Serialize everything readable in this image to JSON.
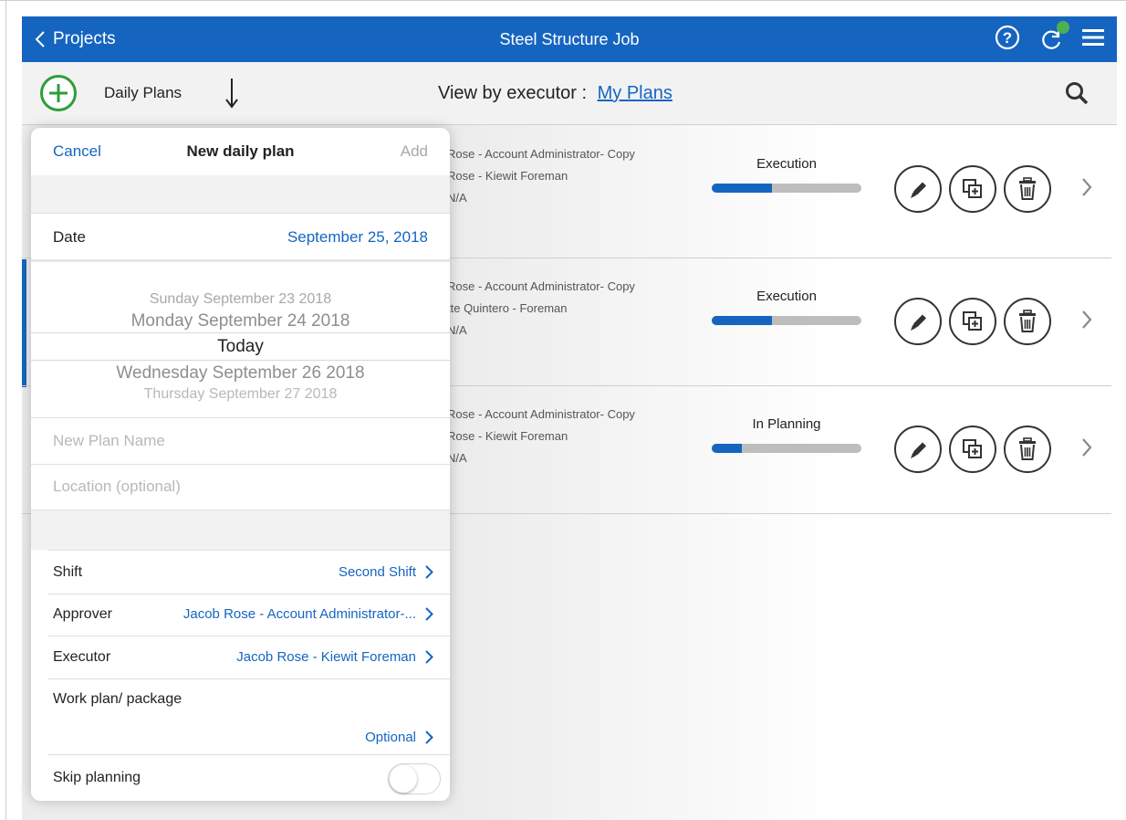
{
  "topbar": {
    "back_label": "Projects",
    "title": "Steel Structure Job",
    "accent_color": "#1565c0",
    "icons": [
      "help-icon",
      "sync-icon",
      "menu-icon"
    ],
    "sync_badge_color": "#4caf50"
  },
  "subheader": {
    "daily_plans_label": "Daily Plans",
    "view_by_label": "View by executor  :",
    "view_by_value": "My Plans"
  },
  "plans": [
    {
      "approver": "Rose - Account Administrator- Copy",
      "executor": "Rose - Kiewit Foreman",
      "location": "N/A",
      "status": "Execution",
      "progress": 0.4
    },
    {
      "approver": "Rose - Account Administrator- Copy",
      "executor": "tte Quintero - Foreman",
      "location": "N/A",
      "status": "Execution",
      "progress": 0.4
    },
    {
      "approver": "Rose - Account Administrator- Copy",
      "executor": "Rose - Kiewit Foreman",
      "location": "N/A",
      "status": "In Planning",
      "progress": 0.2
    }
  ],
  "panel": {
    "cancel_label": "Cancel",
    "title": "New daily plan",
    "add_label": "Add",
    "date_label": "Date",
    "date_value": "September 25, 2018",
    "picker_options": [
      "Sunday September 23 2018",
      "Monday September 24 2018",
      "Today",
      "Wednesday September 26 2018",
      "Thursday September 27 2018"
    ],
    "plan_name_placeholder": "New Plan Name",
    "location_placeholder": "Location (optional)",
    "shift_label": "Shift",
    "shift_value": "Second Shift",
    "approver_label": "Approver",
    "approver_value": "Jacob Rose - Account Administrator-...",
    "executor_label": "Executor",
    "executor_value": "Jacob Rose - Kiewit Foreman",
    "work_plan_label": "Work plan/ package",
    "work_plan_value": "Optional",
    "skip_planning_label": "Skip planning",
    "skip_planning_on": false
  }
}
